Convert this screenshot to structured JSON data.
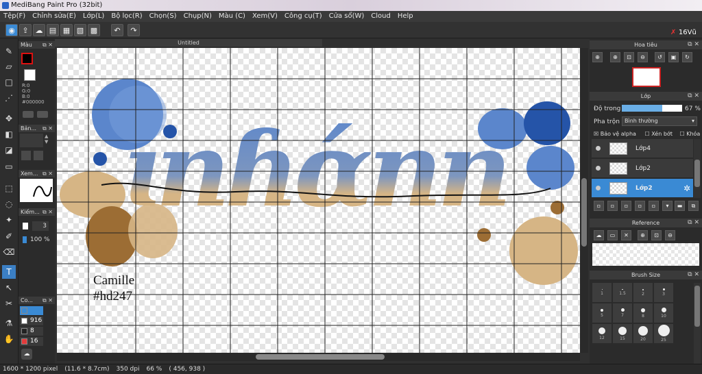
{
  "app": {
    "title": "MediBang Paint Pro (32bit)"
  },
  "notification": {
    "badge": "16",
    "text": "Vũ"
  },
  "menu": [
    "Tệp(F)",
    "Chỉnh sửa(E)",
    "Lớp(L)",
    "Bộ lọc(R)",
    "Chọn(S)",
    "Chụp(N)",
    "Màu (C)",
    "Xem(V)",
    "Công cụ(T)",
    "Cửa sổ(W)",
    "Cloud",
    "Help"
  ],
  "toolbar_icons": [
    "view-icon",
    "export-icon",
    "chat-icon",
    "layers-icon",
    "document-icon",
    "grid-icon",
    "tiles-icon",
    "undo-icon",
    "redo-icon"
  ],
  "color_panel": {
    "title": "Màu",
    "fg": "#000000",
    "bg": "#ffffff",
    "r": "R:0",
    "g": "G:0",
    "b": "B:0",
    "hex": "#000000"
  },
  "brush_panel": {
    "title": "Bản..."
  },
  "preview_panel": {
    "title": "Xem..."
  },
  "brush_size_panel": {
    "title": "Kiếm...",
    "size": "3",
    "opacity": "100 %"
  },
  "color_palette": {
    "title": "Co...",
    "items": [
      {
        "label": "",
        "color": "#3a8ad4"
      },
      {
        "label": "916",
        "color": "#ffffff"
      },
      {
        "label": "8",
        "color": "#222222"
      },
      {
        "label": "16",
        "color": "#e33b3b"
      }
    ]
  },
  "document": {
    "tab": "Untitled",
    "signature_line1": "Camille",
    "signature_line2": "#hd247"
  },
  "navigator": {
    "title": "Hoa tiêu"
  },
  "layer_panel": {
    "title": "Lớp",
    "opacity_label": "Độ trong",
    "opacity_value": "67 %",
    "opacity_fraction": 0.67,
    "blend_label": "Pha trộn",
    "blend_value": "Bình thường",
    "protect_alpha": "Bảo vệ alpha",
    "clipping": "Xén bớt",
    "lock": "Khóa",
    "layers": [
      {
        "name": "Lớp4",
        "selected": false
      },
      {
        "name": "Lớp2",
        "selected": false
      },
      {
        "name": "Lớp2",
        "selected": true
      }
    ]
  },
  "reference": {
    "title": "Reference"
  },
  "brush_size": {
    "title": "Brush Size",
    "sizes": [
      "1",
      "1.5",
      "2",
      "3",
      "5",
      "7",
      "8",
      "10",
      "12",
      "15",
      "20",
      "25"
    ]
  },
  "status": {
    "size": "1600 * 1200 pixel",
    "cm": "(11.6 * 8.7cm)",
    "dpi": "350 dpi",
    "zoom": "66 %",
    "coords": "( 456, 938 )"
  },
  "colors": {
    "blue": "#5b86cc",
    "blue_dark": "#2554a8",
    "tan": "#d6b585",
    "brown": "#9c6d34",
    "accent": "#3a8ad4"
  }
}
